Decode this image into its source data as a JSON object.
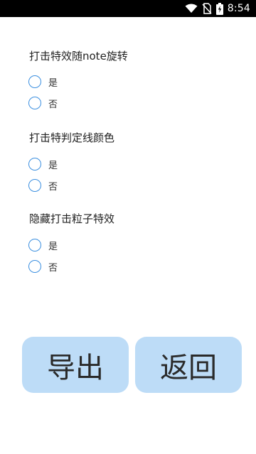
{
  "status_bar": {
    "time": "8:54",
    "icons": [
      "wifi-icon",
      "no-sim-icon",
      "battery-charging-icon"
    ]
  },
  "settings": [
    {
      "title": "打击特效随note旋转",
      "options": [
        {
          "label": "是",
          "selected": false
        },
        {
          "label": "否",
          "selected": false
        }
      ]
    },
    {
      "title": "打击特判定线颜色",
      "options": [
        {
          "label": "是",
          "selected": false
        },
        {
          "label": "否",
          "selected": false
        }
      ]
    },
    {
      "title": "隐藏打击粒子特效",
      "options": [
        {
          "label": "是",
          "selected": false
        },
        {
          "label": "否",
          "selected": false
        }
      ]
    }
  ],
  "buttons": {
    "export_label": "导出",
    "back_label": "返回"
  },
  "colors": {
    "radio_border": "#3b8fe0",
    "button_bg": "#bddcf7"
  }
}
